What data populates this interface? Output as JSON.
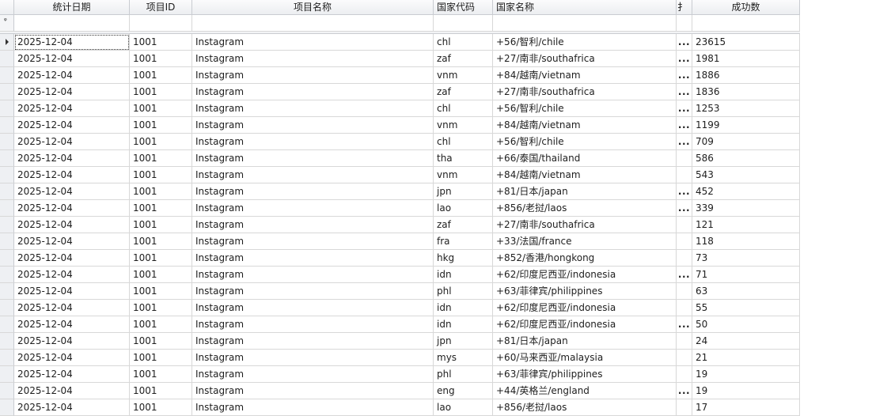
{
  "columns": [
    {
      "key": "date",
      "label": "统计日期"
    },
    {
      "key": "project_id",
      "label": "项目ID"
    },
    {
      "key": "project_name",
      "label": "项目名称"
    },
    {
      "key": "country_code",
      "label": "国家代码"
    },
    {
      "key": "country_name",
      "label": "国家名称"
    },
    {
      "key": "truncated",
      "label": "扌"
    },
    {
      "key": "success_count",
      "label": "成功数"
    }
  ],
  "filter_glyph": "ᵠ",
  "rows": [
    {
      "date": "2025-12-04",
      "project_id": "1001",
      "project_name": "Instagram",
      "country_code": "chl",
      "country_name": "+56/智利/chile",
      "truncated": "...",
      "success_count": "23615"
    },
    {
      "date": "2025-12-04",
      "project_id": "1001",
      "project_name": "Instagram",
      "country_code": "zaf",
      "country_name": "+27/南非/southafrica",
      "truncated": "...",
      "success_count": "1981"
    },
    {
      "date": "2025-12-04",
      "project_id": "1001",
      "project_name": "Instagram",
      "country_code": "vnm",
      "country_name": "+84/越南/vietnam",
      "truncated": "...",
      "success_count": "1886"
    },
    {
      "date": "2025-12-04",
      "project_id": "1001",
      "project_name": "Instagram",
      "country_code": "zaf",
      "country_name": "+27/南非/southafrica",
      "truncated": "...",
      "success_count": "1836"
    },
    {
      "date": "2025-12-04",
      "project_id": "1001",
      "project_name": "Instagram",
      "country_code": "chl",
      "country_name": "+56/智利/chile",
      "truncated": "...",
      "success_count": "1253"
    },
    {
      "date": "2025-12-04",
      "project_id": "1001",
      "project_name": "Instagram",
      "country_code": "vnm",
      "country_name": "+84/越南/vietnam",
      "truncated": "...",
      "success_count": "1199"
    },
    {
      "date": "2025-12-04",
      "project_id": "1001",
      "project_name": "Instagram",
      "country_code": "chl",
      "country_name": "+56/智利/chile",
      "truncated": "...",
      "success_count": "709"
    },
    {
      "date": "2025-12-04",
      "project_id": "1001",
      "project_name": "Instagram",
      "country_code": "tha",
      "country_name": "+66/泰国/thailand",
      "truncated": "",
      "success_count": "586"
    },
    {
      "date": "2025-12-04",
      "project_id": "1001",
      "project_name": "Instagram",
      "country_code": "vnm",
      "country_name": "+84/越南/vietnam",
      "truncated": "",
      "success_count": "543"
    },
    {
      "date": "2025-12-04",
      "project_id": "1001",
      "project_name": "Instagram",
      "country_code": "jpn",
      "country_name": "+81/日本/japan",
      "truncated": "...",
      "success_count": "452"
    },
    {
      "date": "2025-12-04",
      "project_id": "1001",
      "project_name": "Instagram",
      "country_code": "lao",
      "country_name": "+856/老挝/laos",
      "truncated": "...",
      "success_count": "339"
    },
    {
      "date": "2025-12-04",
      "project_id": "1001",
      "project_name": "Instagram",
      "country_code": "zaf",
      "country_name": "+27/南非/southafrica",
      "truncated": "",
      "success_count": "121"
    },
    {
      "date": "2025-12-04",
      "project_id": "1001",
      "project_name": "Instagram",
      "country_code": "fra",
      "country_name": "+33/法国/france",
      "truncated": "",
      "success_count": "118"
    },
    {
      "date": "2025-12-04",
      "project_id": "1001",
      "project_name": "Instagram",
      "country_code": "hkg",
      "country_name": "+852/香港/hongkong",
      "truncated": "",
      "success_count": "73"
    },
    {
      "date": "2025-12-04",
      "project_id": "1001",
      "project_name": "Instagram",
      "country_code": "idn",
      "country_name": "+62/印度尼西亚/indonesia",
      "truncated": "...",
      "success_count": "71"
    },
    {
      "date": "2025-12-04",
      "project_id": "1001",
      "project_name": "Instagram",
      "country_code": "phl",
      "country_name": "+63/菲律宾/philippines",
      "truncated": "",
      "success_count": "63"
    },
    {
      "date": "2025-12-04",
      "project_id": "1001",
      "project_name": "Instagram",
      "country_code": "idn",
      "country_name": "+62/印度尼西亚/indonesia",
      "truncated": "",
      "success_count": "55"
    },
    {
      "date": "2025-12-04",
      "project_id": "1001",
      "project_name": "Instagram",
      "country_code": "idn",
      "country_name": "+62/印度尼西亚/indonesia",
      "truncated": "...",
      "success_count": "50"
    },
    {
      "date": "2025-12-04",
      "project_id": "1001",
      "project_name": "Instagram",
      "country_code": "jpn",
      "country_name": "+81/日本/japan",
      "truncated": "",
      "success_count": "24"
    },
    {
      "date": "2025-12-04",
      "project_id": "1001",
      "project_name": "Instagram",
      "country_code": "mys",
      "country_name": "+60/马来西亚/malaysia",
      "truncated": "",
      "success_count": "21"
    },
    {
      "date": "2025-12-04",
      "project_id": "1001",
      "project_name": "Instagram",
      "country_code": "phl",
      "country_name": "+63/菲律宾/philippines",
      "truncated": "",
      "success_count": "19"
    },
    {
      "date": "2025-12-04",
      "project_id": "1001",
      "project_name": "Instagram",
      "country_code": "eng",
      "country_name": "+44/英格兰/england",
      "truncated": "...",
      "success_count": "19"
    },
    {
      "date": "2025-12-04",
      "project_id": "1001",
      "project_name": "Instagram",
      "country_code": "lao",
      "country_name": "+856/老挝/laos",
      "truncated": "",
      "success_count": "17"
    }
  ]
}
